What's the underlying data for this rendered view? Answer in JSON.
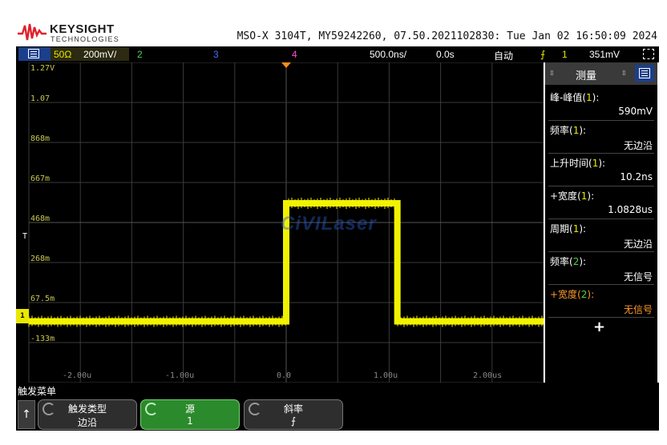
{
  "header": {
    "brand": "KEYSIGHT",
    "brand_sub": "TECHNOLOGIES",
    "model_line": "MSO-X 3104T, MY59242260, 07.50.2021102830: Tue Jan 02 16:50:09 2024"
  },
  "statusbar": {
    "ch1_impedance": "50Ω",
    "ch1_scale": "200mV/",
    "ch2": "2",
    "ch3": "3",
    "ch4": "4",
    "timebase": "500.0ns/",
    "delay": "0.0s",
    "trigger_mode": "自动",
    "trigger_slope_icon": "rising-edge-icon",
    "trigger_source": "1",
    "trigger_level": "351mV",
    "colors": {
      "ch1": "#e8e800",
      "ch2": "#4fd14f",
      "ch3": "#4a6cff",
      "ch4": "#ff4fc8"
    }
  },
  "display": {
    "y_labels": [
      "1.27V",
      "1.07",
      "868m",
      "667m",
      "468m",
      "268m",
      "67.5m",
      "-133m"
    ],
    "x_labels": [
      "-2.00u",
      "-1.00u",
      "0.0",
      "1.00u",
      "2.00us"
    ],
    "trigger_level_marker": "T",
    "ch1_marker": "1",
    "watermark": "CiVILaser",
    "waveform": {
      "channel": "1",
      "color": "#f2f200",
      "low_level_v": 0.0,
      "high_level_v": 0.59,
      "rise_time_us": 0.0,
      "pulse_start_us": 0.0,
      "pulse_end_us": 1.08
    }
  },
  "measurements": {
    "title": "测量",
    "items": [
      {
        "name": "峰-峰值",
        "ch": "1",
        "value": "590mV"
      },
      {
        "name": "频率",
        "ch": "1",
        "value": "无边沿"
      },
      {
        "name": "上升时间",
        "ch": "1",
        "value": "10.2ns"
      },
      {
        "name": "+宽度",
        "ch": "1",
        "value": "1.0828us"
      },
      {
        "name": "周期",
        "ch": "1",
        "value": "无边沿"
      },
      {
        "name": "频率",
        "ch": "2",
        "value": "无信号"
      },
      {
        "name": "+宽度",
        "ch": "2",
        "value": "无信号"
      }
    ],
    "add_symbol": "+"
  },
  "softkeys": {
    "menu_title": "触发菜单",
    "back_symbol": "↑",
    "keys": [
      {
        "label": "触发类型",
        "value": "边沿"
      },
      {
        "label": "源",
        "value": "1"
      },
      {
        "label": "斜率",
        "value": "⨍"
      }
    ]
  }
}
